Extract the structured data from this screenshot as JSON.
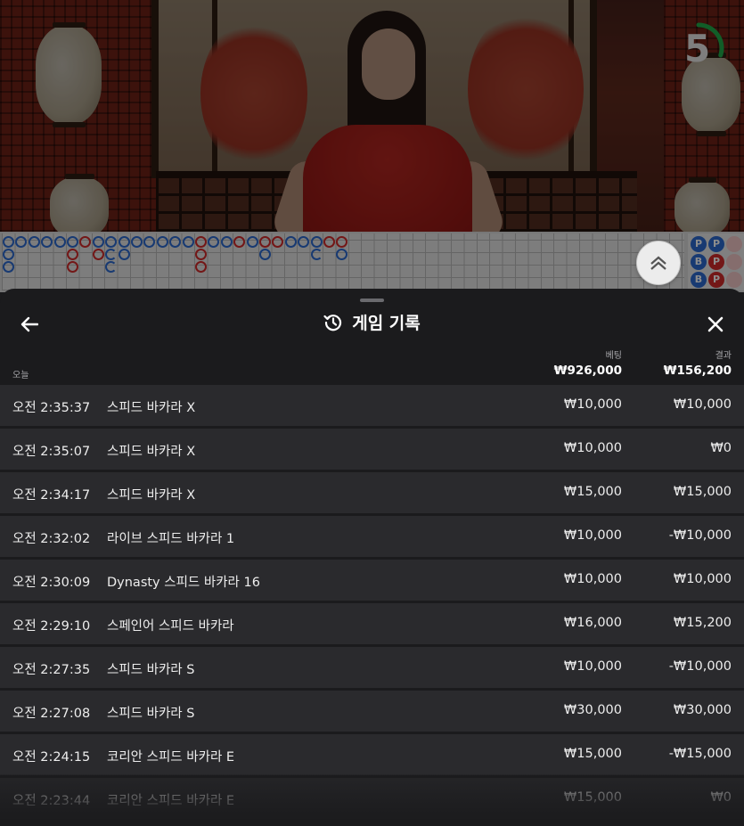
{
  "video": {
    "countdown": "5",
    "countdown_progress": 0.3,
    "timer_color": "#1fa94a"
  },
  "roadmap": {
    "bead_colors": {
      "banker": "#d22a2a",
      "player": "#2d6ad0"
    },
    "side_labels": [
      "P",
      "P",
      "B",
      "P",
      "B"
    ]
  },
  "panel": {
    "title": "게임 기록",
    "back_icon": "arrow-left-icon",
    "close_icon": "close-icon",
    "history_icon": "history-icon",
    "col_bet": "베팅",
    "col_result": "결과",
    "day_label": "오늘",
    "total_bet": "₩926,000",
    "total_result": "₩156,200",
    "rows": [
      {
        "time": "오전 2:35:37",
        "game": "스피드 바카라 X",
        "bet": "₩10,000",
        "result": "₩10,000"
      },
      {
        "time": "오전 2:35:07",
        "game": "스피드 바카라 X",
        "bet": "₩10,000",
        "result": "₩0"
      },
      {
        "time": "오전 2:34:17",
        "game": "스피드 바카라 X",
        "bet": "₩15,000",
        "result": "₩15,000"
      },
      {
        "time": "오전 2:32:02",
        "game": "라이브 스피드 바카라 1",
        "bet": "₩10,000",
        "result": "-₩10,000"
      },
      {
        "time": "오전 2:30:09",
        "game": "Dynasty 스피드 바카라 16",
        "bet": "₩10,000",
        "result": "₩10,000"
      },
      {
        "time": "오전 2:29:10",
        "game": "스페인어 스피드 바카라",
        "bet": "₩16,000",
        "result": "₩15,200"
      },
      {
        "time": "오전 2:27:35",
        "game": "스피드 바카라 S",
        "bet": "₩10,000",
        "result": "-₩10,000"
      },
      {
        "time": "오전 2:27:08",
        "game": "스피드 바카라 S",
        "bet": "₩30,000",
        "result": "₩30,000"
      },
      {
        "time": "오전 2:24:15",
        "game": "코리안 스피드 바카라 E",
        "bet": "₩15,000",
        "result": "-₩15,000"
      },
      {
        "time": "오전 2:23:44",
        "game": "코리안 스피드 바카라 E",
        "bet": "₩15,000",
        "result": "₩0"
      }
    ]
  }
}
